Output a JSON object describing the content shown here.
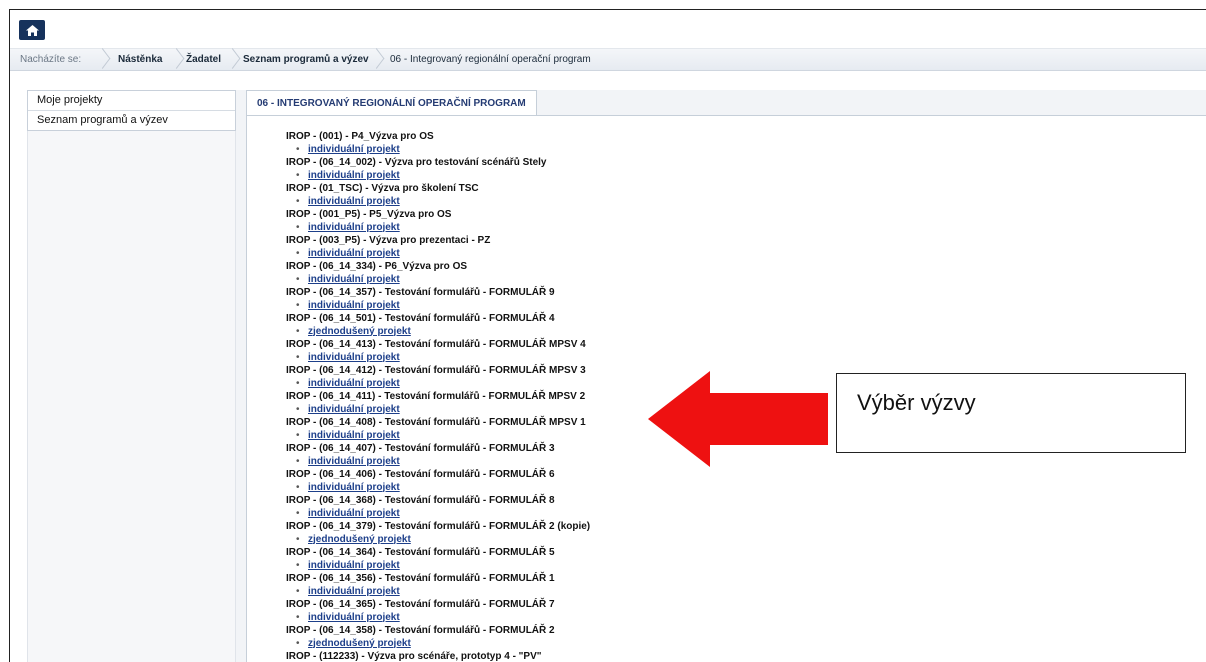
{
  "header": {
    "home_icon": "home-icon"
  },
  "breadcrumb": {
    "label": "Nacházíte se:",
    "items": [
      "Nástěnka",
      "Žadatel",
      "Seznam programů a výzev",
      "06 - Integrovaný regionální operační program"
    ]
  },
  "sidebar": {
    "items": [
      "Moje projekty",
      "Seznam programů a výzev"
    ]
  },
  "tab": {
    "label": "06 - INTEGROVANÝ REGIONÁLNÍ OPERAČNÍ PROGRAM"
  },
  "calls": [
    {
      "title": "IROP - (001) - P4_Výzva pro OS",
      "link": "individuální projekt"
    },
    {
      "title": "IROP - (06_14_002) - Výzva pro testování scénářů Stely",
      "link": "individuální projekt"
    },
    {
      "title": "IROP - (01_TSC) - Výzva pro školení TSC",
      "link": "individuální projekt"
    },
    {
      "title": "IROP - (001_P5) - P5_Výzva pro OS",
      "link": "individuální projekt"
    },
    {
      "title": "IROP - (003_P5) - Výzva pro prezentaci - PZ",
      "link": "individuální projekt"
    },
    {
      "title": "IROP - (06_14_334) - P6_Výzva pro OS",
      "link": "individuální projekt"
    },
    {
      "title": "IROP - (06_14_357) - Testování formulářů - FORMULÁŘ 9",
      "link": "individuální projekt"
    },
    {
      "title": "IROP - (06_14_501) - Testování formulářů - FORMULÁŘ 4",
      "link": "zjednodušený projekt"
    },
    {
      "title": "IROP - (06_14_413) - Testování formulářů - FORMULÁŘ MPSV 4",
      "link": "individuální projekt"
    },
    {
      "title": "IROP - (06_14_412) - Testování formulářů - FORMULÁŘ MPSV 3",
      "link": "individuální projekt"
    },
    {
      "title": "IROP - (06_14_411) - Testování formulářů - FORMULÁŘ MPSV 2",
      "link": "individuální projekt"
    },
    {
      "title": "IROP - (06_14_408) - Testování formulářů - FORMULÁŘ MPSV 1",
      "link": "individuální projekt"
    },
    {
      "title": "IROP - (06_14_407) - Testování formulářů - FORMULÁŘ 3",
      "link": "individuální projekt"
    },
    {
      "title": "IROP - (06_14_406) - Testování formulářů - FORMULÁŘ 6",
      "link": "individuální projekt"
    },
    {
      "title": "IROP - (06_14_368) - Testování formulářů - FORMULÁŘ 8",
      "link": "individuální projekt"
    },
    {
      "title": "IROP - (06_14_379) - Testování formulářů - FORMULÁŘ 2 (kopie)",
      "link": "zjednodušený projekt"
    },
    {
      "title": "IROP - (06_14_364) - Testování formulářů - FORMULÁŘ 5",
      "link": "individuální projekt"
    },
    {
      "title": "IROP - (06_14_356) - Testování formulářů - FORMULÁŘ 1",
      "link": "individuální projekt"
    },
    {
      "title": "IROP - (06_14_365) - Testování formulářů - FORMULÁŘ 7",
      "link": "individuální projekt"
    },
    {
      "title": "IROP - (06_14_358) - Testování formulářů - FORMULÁŘ 2",
      "link": "zjednodušený projekt"
    },
    {
      "title": "IROP - (112233) - Výzva pro scénáře, prototyp 4 - \"PV\"",
      "link": ""
    }
  ],
  "annotation": {
    "label": "Výběr výzvy",
    "arrow_color": "#ee1111"
  },
  "colors": {
    "brand_navy": "#16325c",
    "link_blue": "#1d3f8a",
    "tab_text": "#243b73"
  }
}
